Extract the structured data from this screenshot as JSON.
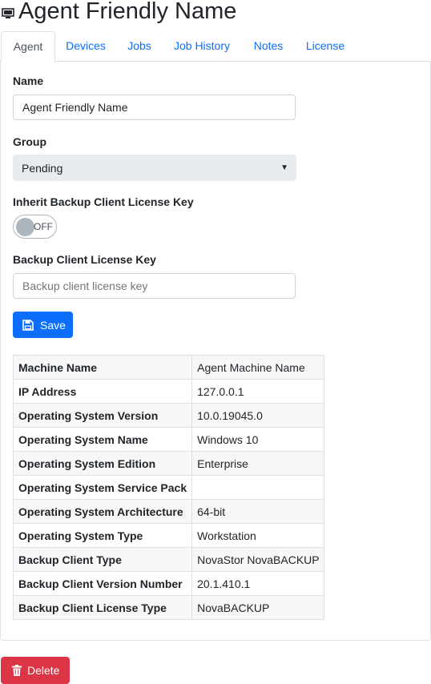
{
  "header": {
    "title": "Agent Friendly Name",
    "icon": "computer-icon"
  },
  "tabs": [
    {
      "label": "Agent",
      "active": true
    },
    {
      "label": "Devices",
      "active": false
    },
    {
      "label": "Jobs",
      "active": false
    },
    {
      "label": "Job History",
      "active": false
    },
    {
      "label": "Notes",
      "active": false
    },
    {
      "label": "License",
      "active": false
    }
  ],
  "form": {
    "name_label": "Name",
    "name_value": "Agent Friendly Name",
    "group_label": "Group",
    "group_value": "Pending",
    "inherit_label": "Inherit Backup Client License Key",
    "inherit_toggle_text": "OFF",
    "license_key_label": "Backup Client License Key",
    "license_key_placeholder": "Backup client license key",
    "save_label": "Save"
  },
  "info_table": [
    {
      "key": "Machine Name",
      "value": "Agent Machine Name"
    },
    {
      "key": "IP Address",
      "value": "127.0.0.1"
    },
    {
      "key": "Operating System Version",
      "value": "10.0.19045.0"
    },
    {
      "key": "Operating System Name",
      "value": "Windows 10"
    },
    {
      "key": "Operating System Edition",
      "value": "Enterprise"
    },
    {
      "key": "Operating System Service Pack",
      "value": ""
    },
    {
      "key": "Operating System Architecture",
      "value": "64-bit"
    },
    {
      "key": "Operating System Type",
      "value": "Workstation"
    },
    {
      "key": "Backup Client Type",
      "value": "NovaStor NovaBACKUP"
    },
    {
      "key": "Backup Client Version Number",
      "value": "20.1.410.1"
    },
    {
      "key": "Backup Client License Type",
      "value": "NovaBACKUP"
    }
  ],
  "actions": {
    "delete_label": "Delete"
  },
  "colors": {
    "primary": "#0d6efd",
    "danger": "#dc3545",
    "border": "#dee2e6",
    "select_bg": "#e9ecef"
  }
}
